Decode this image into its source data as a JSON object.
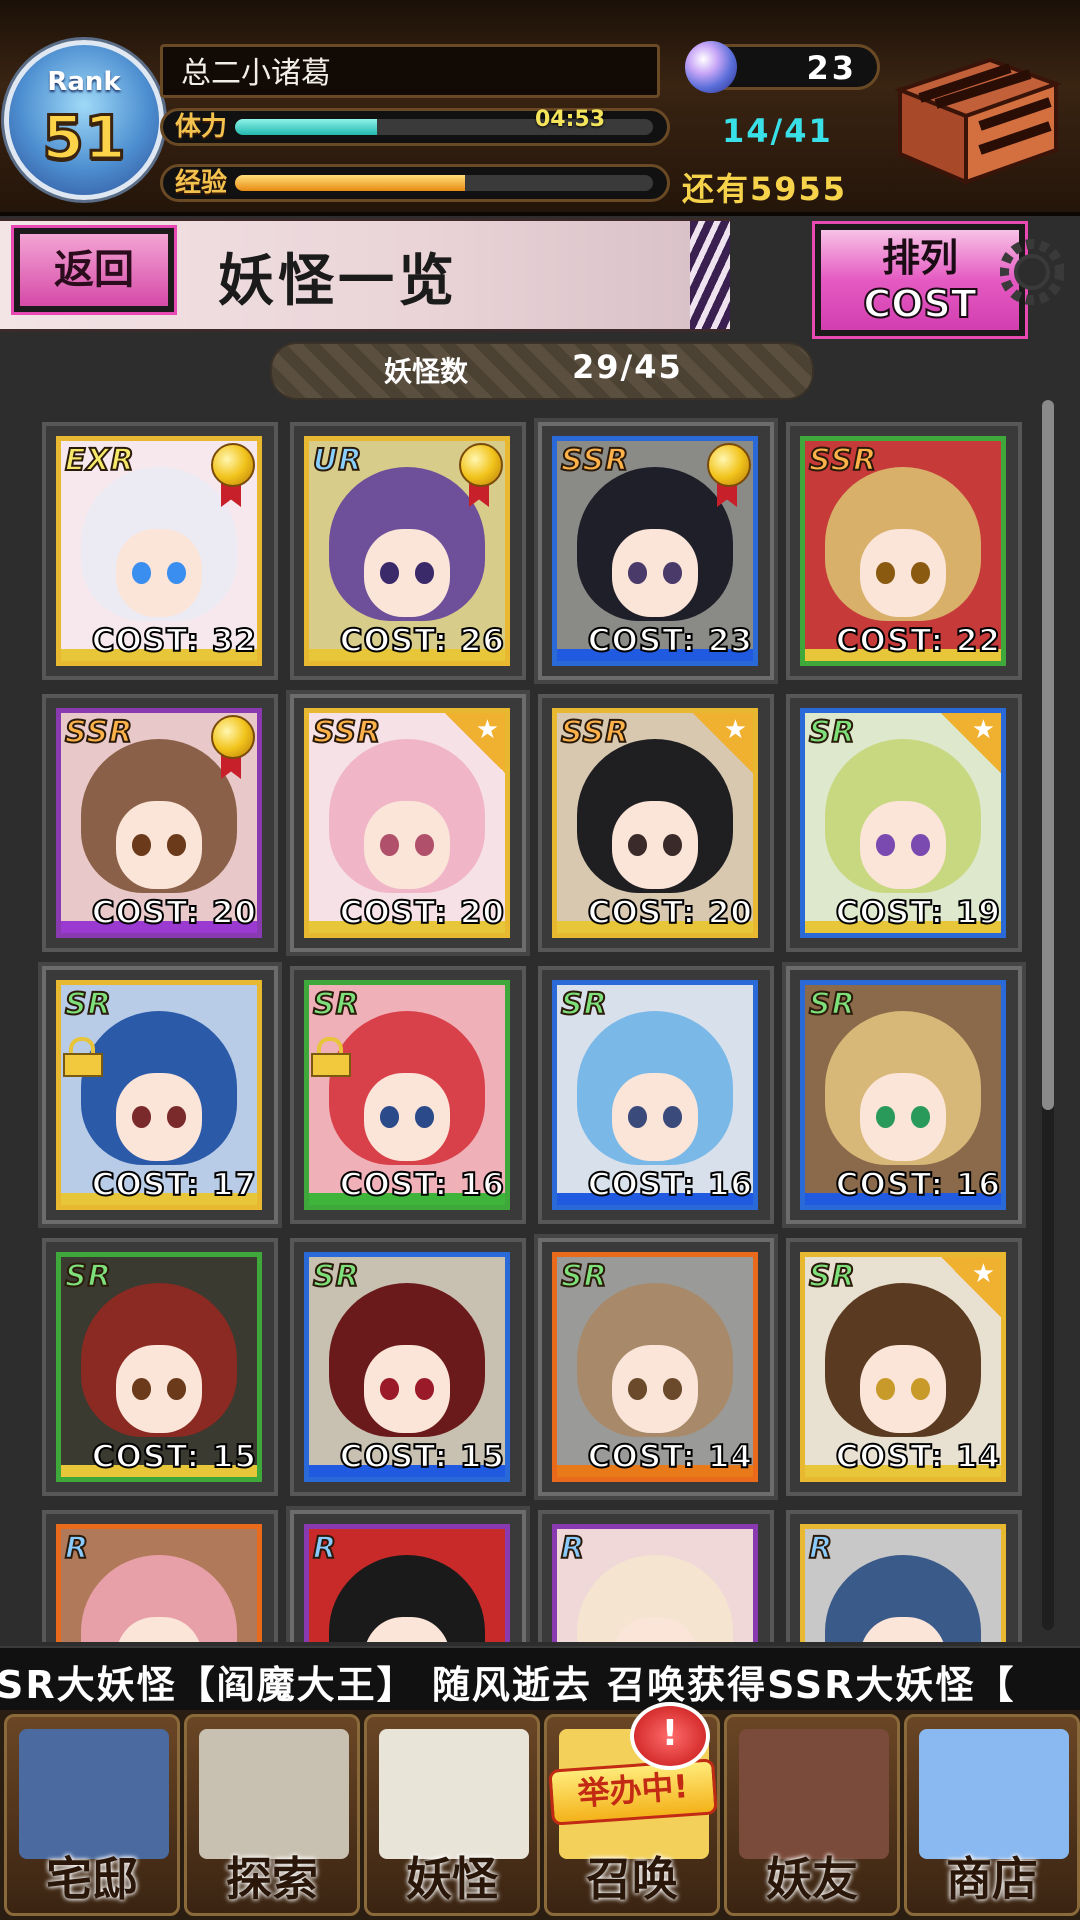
{
  "player": {
    "rank_label": "Rank",
    "rank": "51",
    "name": "总二小诸葛",
    "stamina_label": "体力",
    "stamina_timer": "04:53",
    "stamina_fill": 0.34,
    "exp_label": "经验",
    "exp_fill": 0.55,
    "gems": "23",
    "stamina_count": "14/41",
    "exp_remaining": "还有5955"
  },
  "header": {
    "back_label": "返回",
    "title": "妖怪一览",
    "sort_line1": "排列",
    "sort_line2": "COST"
  },
  "yokai_count": {
    "label": "妖怪数",
    "value": "29/45"
  },
  "cards": [
    {
      "rarity": "EXR",
      "cost": "COST: 32",
      "badge": "medal",
      "frame": "#e8b830",
      "bar": "#e8c63a",
      "hair": "#ecebf4",
      "eye": "#3a8ef0",
      "bg": "#f6e8ec"
    },
    {
      "rarity": "UR",
      "cost": "COST: 26",
      "badge": "medal",
      "frame": "#e8b830",
      "bar": "#e8c63a",
      "hair": "#6e4f9a",
      "eye": "#3a2a6a",
      "bg": "#d8cc8a"
    },
    {
      "rarity": "SSR",
      "cost": "COST: 23",
      "badge": "medal",
      "frame": "#2a6ad8",
      "bar": "#1f5ae0",
      "hair": "#1f1f2a",
      "eye": "#4a3a6a",
      "bg": "#8a8a86"
    },
    {
      "rarity": "SSR",
      "cost": "COST: 22",
      "badge": "none",
      "frame": "#3fa83a",
      "bar": "#e8c63a",
      "hair": "#d8b06a",
      "eye": "#8a5a10",
      "bg": "#c73a3a"
    },
    {
      "rarity": "SSR",
      "cost": "COST: 20",
      "badge": "medal",
      "frame": "#8a3ab0",
      "bar": "#9a3ad0",
      "hair": "#8a6048",
      "eye": "#6a3a1a",
      "bg": "#e8c8c8"
    },
    {
      "rarity": "SSR",
      "cost": "COST: 20",
      "badge": "star",
      "frame": "#e8b830",
      "bar": "#e8c63a",
      "hair": "#f0b6c8",
      "eye": "#b0506a",
      "bg": "#f6e2e6"
    },
    {
      "rarity": "SSR",
      "cost": "COST: 20",
      "badge": "star",
      "frame": "#e8b830",
      "bar": "#e8c63a",
      "hair": "#1f1f22",
      "eye": "#3a2a2a",
      "bg": "#d8c8b0"
    },
    {
      "rarity": "SR",
      "cost": "COST: 19",
      "badge": "star",
      "frame": "#2a6ad8",
      "bar": "#e8c63a",
      "hair": "#c8d880",
      "eye": "#7a4ab0",
      "bg": "#dde8cc"
    },
    {
      "rarity": "SR",
      "cost": "COST: 17",
      "badge": "lock",
      "frame": "#e8b830",
      "bar": "#e8c63a",
      "hair": "#2a5aa8",
      "eye": "#7a2a2a",
      "bg": "#b8cce8"
    },
    {
      "rarity": "SR",
      "cost": "COST: 16",
      "badge": "lock",
      "frame": "#3fa83a",
      "bar": "#3fb43a",
      "hair": "#d8404a",
      "eye": "#2a4a8a",
      "bg": "#f0b0b8"
    },
    {
      "rarity": "SR",
      "cost": "COST: 16",
      "badge": "none",
      "frame": "#2a6ad8",
      "bar": "#1f5ae0",
      "hair": "#7ab8e8",
      "eye": "#3a4a7a",
      "bg": "#d8e0ec"
    },
    {
      "rarity": "SR",
      "cost": "COST: 16",
      "badge": "none",
      "frame": "#2a6ad8",
      "bar": "#1f5ae0",
      "hair": "#d8b878",
      "eye": "#2a9a5a",
      "bg": "#8a6a4a"
    },
    {
      "rarity": "SR",
      "cost": "COST: 15",
      "badge": "none",
      "frame": "#3fa83a",
      "bar": "#e8c63a",
      "hair": "#8a2a22",
      "eye": "#6a3a1a",
      "bg": "#3a3a30"
    },
    {
      "rarity": "SR",
      "cost": "COST: 15",
      "badge": "none",
      "frame": "#2a6ad8",
      "bar": "#1f5ae0",
      "hair": "#6a1a1a",
      "eye": "#9a1a2a",
      "bg": "#c8c0b0"
    },
    {
      "rarity": "SR",
      "cost": "COST: 14",
      "badge": "none",
      "frame": "#e86a1a",
      "bar": "#e87a1a",
      "hair": "#a88a6a",
      "eye": "#6a4a2a",
      "bg": "#9a9a98"
    },
    {
      "rarity": "SR",
      "cost": "COST: 14",
      "badge": "star",
      "frame": "#e8b830",
      "bar": "#e8c63a",
      "hair": "#5a3a20",
      "eye": "#c89a2a",
      "bg": "#e8e0d0"
    },
    {
      "rarity": "R",
      "cost": "",
      "badge": "none",
      "frame": "#e86a1a",
      "bar": "#e87a1a",
      "hair": "#e8a0a8",
      "eye": "#2a8a5a",
      "bg": "#b07a5a"
    },
    {
      "rarity": "R",
      "cost": "",
      "badge": "none",
      "frame": "#8a3ab0",
      "bar": "#9a3ad0",
      "hair": "#1a1a1a",
      "eye": "#3a2a2a",
      "bg": "#c82a2a"
    },
    {
      "rarity": "R",
      "cost": "",
      "badge": "none",
      "frame": "#8a3ab0",
      "bar": "#9a3ad0",
      "hair": "#f4e4d0",
      "eye": "#c83a6a",
      "bg": "#f0d8d8"
    },
    {
      "rarity": "R",
      "cost": "",
      "badge": "none",
      "frame": "#e8b830",
      "bar": "#e8c63a",
      "hair": "#3a5a8a",
      "eye": "#9a2a2a",
      "bg": "#c8c8c8"
    }
  ],
  "ticker": "SR大妖怪【阎魔大王】        随风逝去 召唤获得SSR大妖怪【",
  "nav": [
    {
      "label": "宅邸",
      "art": "#4a6aa0"
    },
    {
      "label": "探索",
      "art": "#c8c0b0"
    },
    {
      "label": "妖怪",
      "art": "#e8e4d8"
    },
    {
      "label": "召唤",
      "art": "#f2d05a"
    },
    {
      "label": "妖友",
      "art": "#7a4a3a"
    },
    {
      "label": "商店",
      "art": "#8ab8f0"
    }
  ],
  "summon_event_tag": "举办中!",
  "summon_alert": "!"
}
